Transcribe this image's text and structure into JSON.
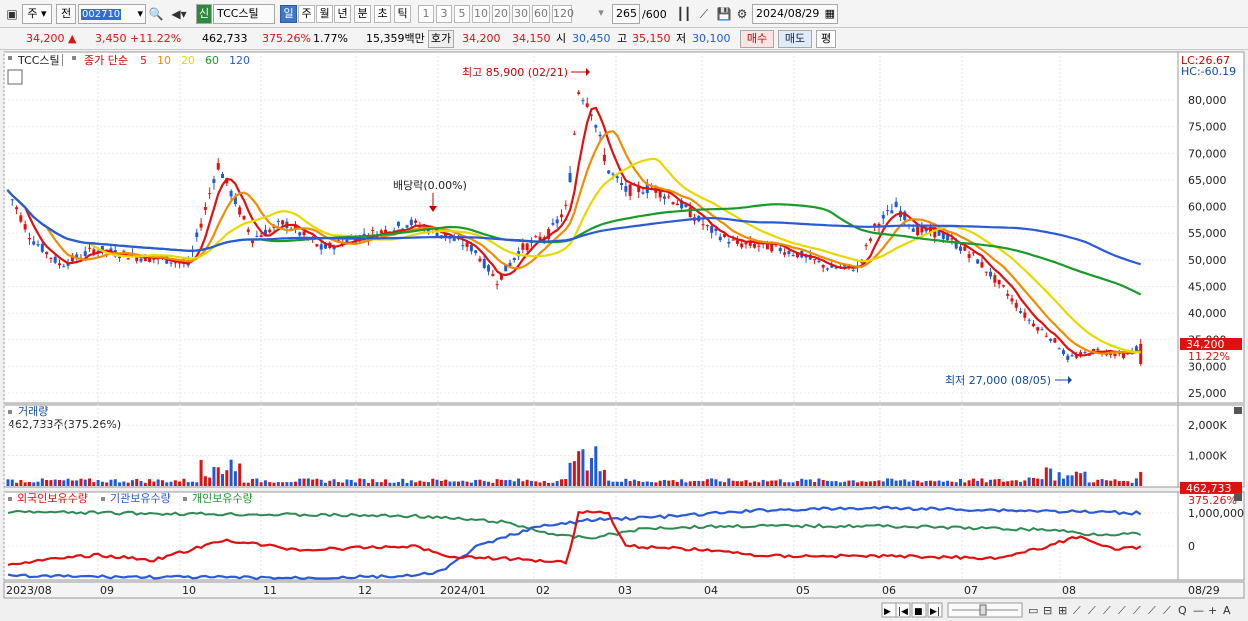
{
  "toolbar": {
    "market": "주",
    "mode": "전",
    "code": "002710",
    "badge": "신",
    "name": "TCC스틸",
    "periods": [
      "일",
      "주",
      "월",
      "년",
      "분",
      "초",
      "틱"
    ],
    "selected_period": "일",
    "intervals": [
      "1",
      "3",
      "5",
      "10",
      "20",
      "30",
      "60",
      "120"
    ],
    "count": "265",
    "max_count": "/600",
    "date": "2024/08/29"
  },
  "quote": {
    "price": "34,200",
    "arrow": "▲",
    "change": "3,450",
    "change_rate": "+11.22%",
    "volume": "462,733",
    "volume_rate": "375.26%",
    "turnover": "1.77%",
    "amount": "15,359백만",
    "hoga_label": "호가",
    "ask": "34,200",
    "bid": "34,150",
    "open_label": "시",
    "open": "30,450",
    "high_label": "고",
    "high": "35,150",
    "low_label": "저",
    "low": "30,100",
    "buy_label": "매수",
    "sell_label": "매도",
    "avg_label": "평"
  },
  "price_panel": {
    "stock_label": "TCC스틸",
    "ma_label": "종가 단순",
    "ma_periods": [
      {
        "p": "5",
        "color": "#e01010"
      },
      {
        "p": "10",
        "color": "#f08c00"
      },
      {
        "p": "20",
        "color": "#e8d800"
      },
      {
        "p": "60",
        "color": "#1a9a2a"
      },
      {
        "p": "120",
        "color": "#2a5ad8"
      }
    ],
    "lc": "LC:26.67",
    "hc": "HC:-60.19",
    "y_ticks": [
      "80,000",
      "75,000",
      "70,000",
      "65,000",
      "60,000",
      "55,000",
      "50,000",
      "45,000",
      "40,000",
      "35,000",
      "30,000",
      "25,000"
    ],
    "high_note": "최고 85,900 (02/21)",
    "low_note": "최저 27,000 (08/05)",
    "dividend_note": "배당락(0.00%)",
    "current_price": "34,200",
    "current_rate": "11.22%"
  },
  "volume_panel": {
    "title": "거래량",
    "value": "462,733주(375.26%)",
    "y_ticks": [
      "2,000K",
      "1,000K"
    ],
    "current": "462,733",
    "current_rate": "375.26%"
  },
  "holding_panel": {
    "legend": [
      {
        "name": "외국인보유수량",
        "color": "#e01010"
      },
      {
        "name": "기관보유수량",
        "color": "#2a5ad8"
      },
      {
        "name": "개인보유수량",
        "color": "#1a9a2a"
      }
    ],
    "y_ticks": [
      "1,000,000",
      "0"
    ]
  },
  "x_axis": {
    "labels": [
      "2023/08",
      "09",
      "10",
      "11",
      "12",
      "2024/01",
      "02",
      "03",
      "04",
      "05",
      "06",
      "07",
      "08"
    ],
    "end_label": "08/29"
  },
  "colors": {
    "up": "#e01010",
    "down": "#1e5ad8",
    "accent": "#3f78c8"
  }
}
